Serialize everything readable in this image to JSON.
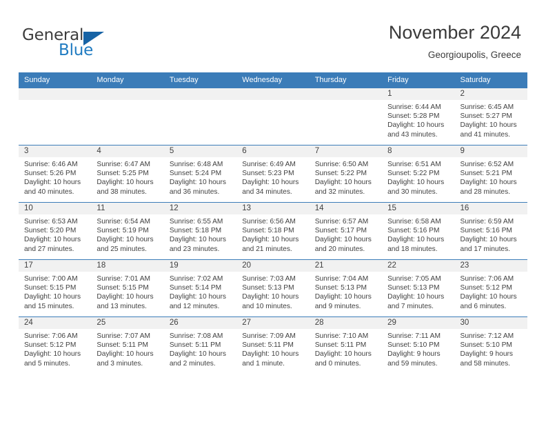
{
  "brand": {
    "name_part1": "General",
    "name_part2": "Blue"
  },
  "header": {
    "title": "November 2024",
    "location": "Georgioupolis, Greece"
  },
  "weekday_headers": [
    "Sunday",
    "Monday",
    "Tuesday",
    "Wednesday",
    "Thursday",
    "Friday",
    "Saturday"
  ],
  "labels": {
    "sunrise_prefix": "Sunrise:",
    "sunset_prefix": "Sunset:",
    "daylight_prefix": "Daylight:"
  },
  "colors": {
    "header_band": "#3b7cb8",
    "daynum_band": "#f1f1f1",
    "brand_blue": "#1f7bc1",
    "text": "#3f3f3f"
  },
  "weeks": [
    [
      {
        "empty": true
      },
      {
        "empty": true
      },
      {
        "empty": true
      },
      {
        "empty": true
      },
      {
        "empty": true
      },
      {
        "day": "1",
        "sunrise": "Sunrise: 6:44 AM",
        "sunset": "Sunset: 5:28 PM",
        "daylight_line1": "Daylight: 10 hours",
        "daylight_line2": "and 43 minutes."
      },
      {
        "day": "2",
        "sunrise": "Sunrise: 6:45 AM",
        "sunset": "Sunset: 5:27 PM",
        "daylight_line1": "Daylight: 10 hours",
        "daylight_line2": "and 41 minutes."
      }
    ],
    [
      {
        "day": "3",
        "sunrise": "Sunrise: 6:46 AM",
        "sunset": "Sunset: 5:26 PM",
        "daylight_line1": "Daylight: 10 hours",
        "daylight_line2": "and 40 minutes."
      },
      {
        "day": "4",
        "sunrise": "Sunrise: 6:47 AM",
        "sunset": "Sunset: 5:25 PM",
        "daylight_line1": "Daylight: 10 hours",
        "daylight_line2": "and 38 minutes."
      },
      {
        "day": "5",
        "sunrise": "Sunrise: 6:48 AM",
        "sunset": "Sunset: 5:24 PM",
        "daylight_line1": "Daylight: 10 hours",
        "daylight_line2": "and 36 minutes."
      },
      {
        "day": "6",
        "sunrise": "Sunrise: 6:49 AM",
        "sunset": "Sunset: 5:23 PM",
        "daylight_line1": "Daylight: 10 hours",
        "daylight_line2": "and 34 minutes."
      },
      {
        "day": "7",
        "sunrise": "Sunrise: 6:50 AM",
        "sunset": "Sunset: 5:22 PM",
        "daylight_line1": "Daylight: 10 hours",
        "daylight_line2": "and 32 minutes."
      },
      {
        "day": "8",
        "sunrise": "Sunrise: 6:51 AM",
        "sunset": "Sunset: 5:22 PM",
        "daylight_line1": "Daylight: 10 hours",
        "daylight_line2": "and 30 minutes."
      },
      {
        "day": "9",
        "sunrise": "Sunrise: 6:52 AM",
        "sunset": "Sunset: 5:21 PM",
        "daylight_line1": "Daylight: 10 hours",
        "daylight_line2": "and 28 minutes."
      }
    ],
    [
      {
        "day": "10",
        "sunrise": "Sunrise: 6:53 AM",
        "sunset": "Sunset: 5:20 PM",
        "daylight_line1": "Daylight: 10 hours",
        "daylight_line2": "and 27 minutes."
      },
      {
        "day": "11",
        "sunrise": "Sunrise: 6:54 AM",
        "sunset": "Sunset: 5:19 PM",
        "daylight_line1": "Daylight: 10 hours",
        "daylight_line2": "and 25 minutes."
      },
      {
        "day": "12",
        "sunrise": "Sunrise: 6:55 AM",
        "sunset": "Sunset: 5:18 PM",
        "daylight_line1": "Daylight: 10 hours",
        "daylight_line2": "and 23 minutes."
      },
      {
        "day": "13",
        "sunrise": "Sunrise: 6:56 AM",
        "sunset": "Sunset: 5:18 PM",
        "daylight_line1": "Daylight: 10 hours",
        "daylight_line2": "and 21 minutes."
      },
      {
        "day": "14",
        "sunrise": "Sunrise: 6:57 AM",
        "sunset": "Sunset: 5:17 PM",
        "daylight_line1": "Daylight: 10 hours",
        "daylight_line2": "and 20 minutes."
      },
      {
        "day": "15",
        "sunrise": "Sunrise: 6:58 AM",
        "sunset": "Sunset: 5:16 PM",
        "daylight_line1": "Daylight: 10 hours",
        "daylight_line2": "and 18 minutes."
      },
      {
        "day": "16",
        "sunrise": "Sunrise: 6:59 AM",
        "sunset": "Sunset: 5:16 PM",
        "daylight_line1": "Daylight: 10 hours",
        "daylight_line2": "and 17 minutes."
      }
    ],
    [
      {
        "day": "17",
        "sunrise": "Sunrise: 7:00 AM",
        "sunset": "Sunset: 5:15 PM",
        "daylight_line1": "Daylight: 10 hours",
        "daylight_line2": "and 15 minutes."
      },
      {
        "day": "18",
        "sunrise": "Sunrise: 7:01 AM",
        "sunset": "Sunset: 5:15 PM",
        "daylight_line1": "Daylight: 10 hours",
        "daylight_line2": "and 13 minutes."
      },
      {
        "day": "19",
        "sunrise": "Sunrise: 7:02 AM",
        "sunset": "Sunset: 5:14 PM",
        "daylight_line1": "Daylight: 10 hours",
        "daylight_line2": "and 12 minutes."
      },
      {
        "day": "20",
        "sunrise": "Sunrise: 7:03 AM",
        "sunset": "Sunset: 5:13 PM",
        "daylight_line1": "Daylight: 10 hours",
        "daylight_line2": "and 10 minutes."
      },
      {
        "day": "21",
        "sunrise": "Sunrise: 7:04 AM",
        "sunset": "Sunset: 5:13 PM",
        "daylight_line1": "Daylight: 10 hours",
        "daylight_line2": "and 9 minutes."
      },
      {
        "day": "22",
        "sunrise": "Sunrise: 7:05 AM",
        "sunset": "Sunset: 5:13 PM",
        "daylight_line1": "Daylight: 10 hours",
        "daylight_line2": "and 7 minutes."
      },
      {
        "day": "23",
        "sunrise": "Sunrise: 7:06 AM",
        "sunset": "Sunset: 5:12 PM",
        "daylight_line1": "Daylight: 10 hours",
        "daylight_line2": "and 6 minutes."
      }
    ],
    [
      {
        "day": "24",
        "sunrise": "Sunrise: 7:06 AM",
        "sunset": "Sunset: 5:12 PM",
        "daylight_line1": "Daylight: 10 hours",
        "daylight_line2": "and 5 minutes."
      },
      {
        "day": "25",
        "sunrise": "Sunrise: 7:07 AM",
        "sunset": "Sunset: 5:11 PM",
        "daylight_line1": "Daylight: 10 hours",
        "daylight_line2": "and 3 minutes."
      },
      {
        "day": "26",
        "sunrise": "Sunrise: 7:08 AM",
        "sunset": "Sunset: 5:11 PM",
        "daylight_line1": "Daylight: 10 hours",
        "daylight_line2": "and 2 minutes."
      },
      {
        "day": "27",
        "sunrise": "Sunrise: 7:09 AM",
        "sunset": "Sunset: 5:11 PM",
        "daylight_line1": "Daylight: 10 hours",
        "daylight_line2": "and 1 minute."
      },
      {
        "day": "28",
        "sunrise": "Sunrise: 7:10 AM",
        "sunset": "Sunset: 5:11 PM",
        "daylight_line1": "Daylight: 10 hours",
        "daylight_line2": "and 0 minutes."
      },
      {
        "day": "29",
        "sunrise": "Sunrise: 7:11 AM",
        "sunset": "Sunset: 5:10 PM",
        "daylight_line1": "Daylight: 9 hours",
        "daylight_line2": "and 59 minutes."
      },
      {
        "day": "30",
        "sunrise": "Sunrise: 7:12 AM",
        "sunset": "Sunset: 5:10 PM",
        "daylight_line1": "Daylight: 9 hours",
        "daylight_line2": "and 58 minutes."
      }
    ]
  ]
}
